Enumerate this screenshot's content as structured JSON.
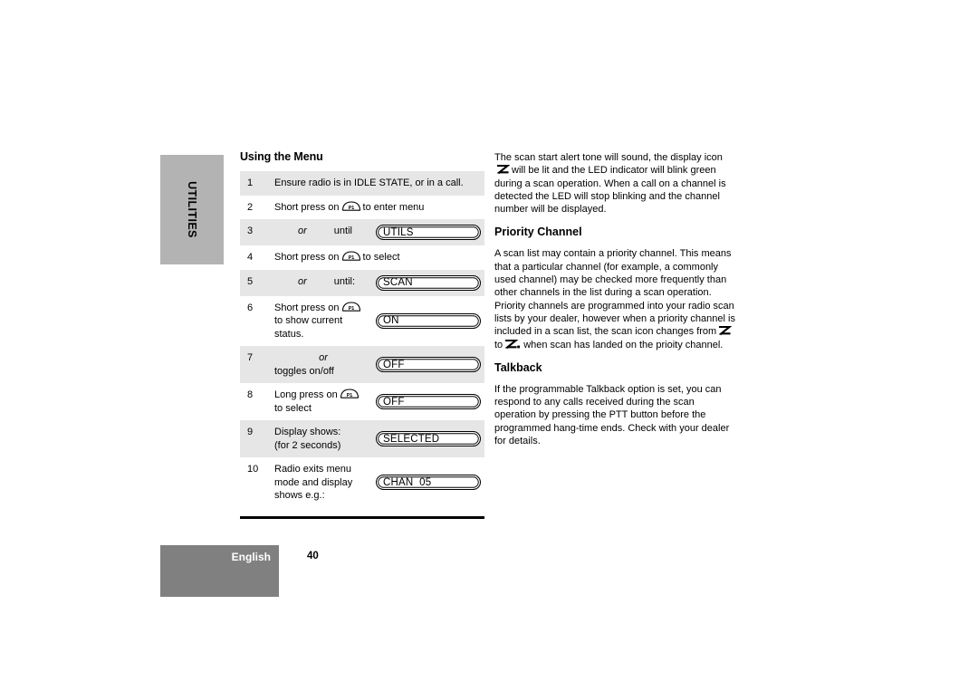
{
  "side_tab": {
    "label": "UTILITIES"
  },
  "left_column": {
    "heading": "Using the Menu",
    "steps": [
      {
        "num": "1",
        "lines": [
          "Ensure radio is in IDLE STATE, or in a call."
        ],
        "display": null,
        "shaded": true
      },
      {
        "num": "2",
        "lines": [
          "Short press on",
          "to enter menu"
        ],
        "has_p1": true,
        "display": null,
        "shaded": false
      },
      {
        "num": "3",
        "lines": [
          "or",
          "until"
        ],
        "display": "UTILS",
        "shaded": true
      },
      {
        "num": "4",
        "lines": [
          "Short press on",
          "to select"
        ],
        "has_p1": true,
        "display": null,
        "shaded": false
      },
      {
        "num": "5",
        "lines": [
          "or",
          "until:"
        ],
        "display": "SCAN",
        "shaded": true
      },
      {
        "num": "6",
        "lines": [
          "Short press on",
          "to show current",
          "status."
        ],
        "has_p1": true,
        "display": "ON",
        "shaded": false
      },
      {
        "num": "7",
        "lines": [
          "or",
          "toggles on/off"
        ],
        "display": "OFF",
        "shaded": true
      },
      {
        "num": "8",
        "lines": [
          "Long press on",
          "to select"
        ],
        "has_p1": true,
        "display": "OFF",
        "shaded": false
      },
      {
        "num": "9",
        "lines": [
          "Display shows:",
          "(for 2 seconds)"
        ],
        "display": "SELECTED",
        "shaded": true
      },
      {
        "num": "10",
        "lines": [
          "Radio exits menu",
          "mode and display",
          "shows e.g.:"
        ],
        "display": "CHAN  05",
        "shaded": false
      }
    ],
    "p1_button_label": "P1"
  },
  "right_column": {
    "scan_intro_part1": "The scan start alert tone will sound, the display icon",
    "scan_intro_part2": "will be lit and the LED indicator will blink green during a scan operation. When a call on a channel is detected the LED will stop blinking and the channel number will be displayed.",
    "priority_heading": "Priority Channel",
    "priority_part1": "A scan list may contain a priority channel. This means that a particular channel (for example, a commonly used channel) may be checked more frequently than other channels in the list during a scan operation. Priority channels are programmed into your radio scan lists by your dealer, however when a priority channel is included in a scan list, the scan icon changes from",
    "priority_part2": "to",
    "priority_part3": "when scan has landed on the prioity channel.",
    "talkback_heading": "Talkback",
    "talkback_body": "If the programmable Talkback option is set, you can respond to any calls received during the scan operation by pressing the PTT button before the programmed hang-time ends. Check with your dealer for details."
  },
  "footer": {
    "language": "English",
    "page_number": "40"
  },
  "colors": {
    "side_tab_bg": "#b3b3b3",
    "footer_bg": "#808080",
    "row_shade": "#e6e6e6",
    "text": "#000000"
  }
}
